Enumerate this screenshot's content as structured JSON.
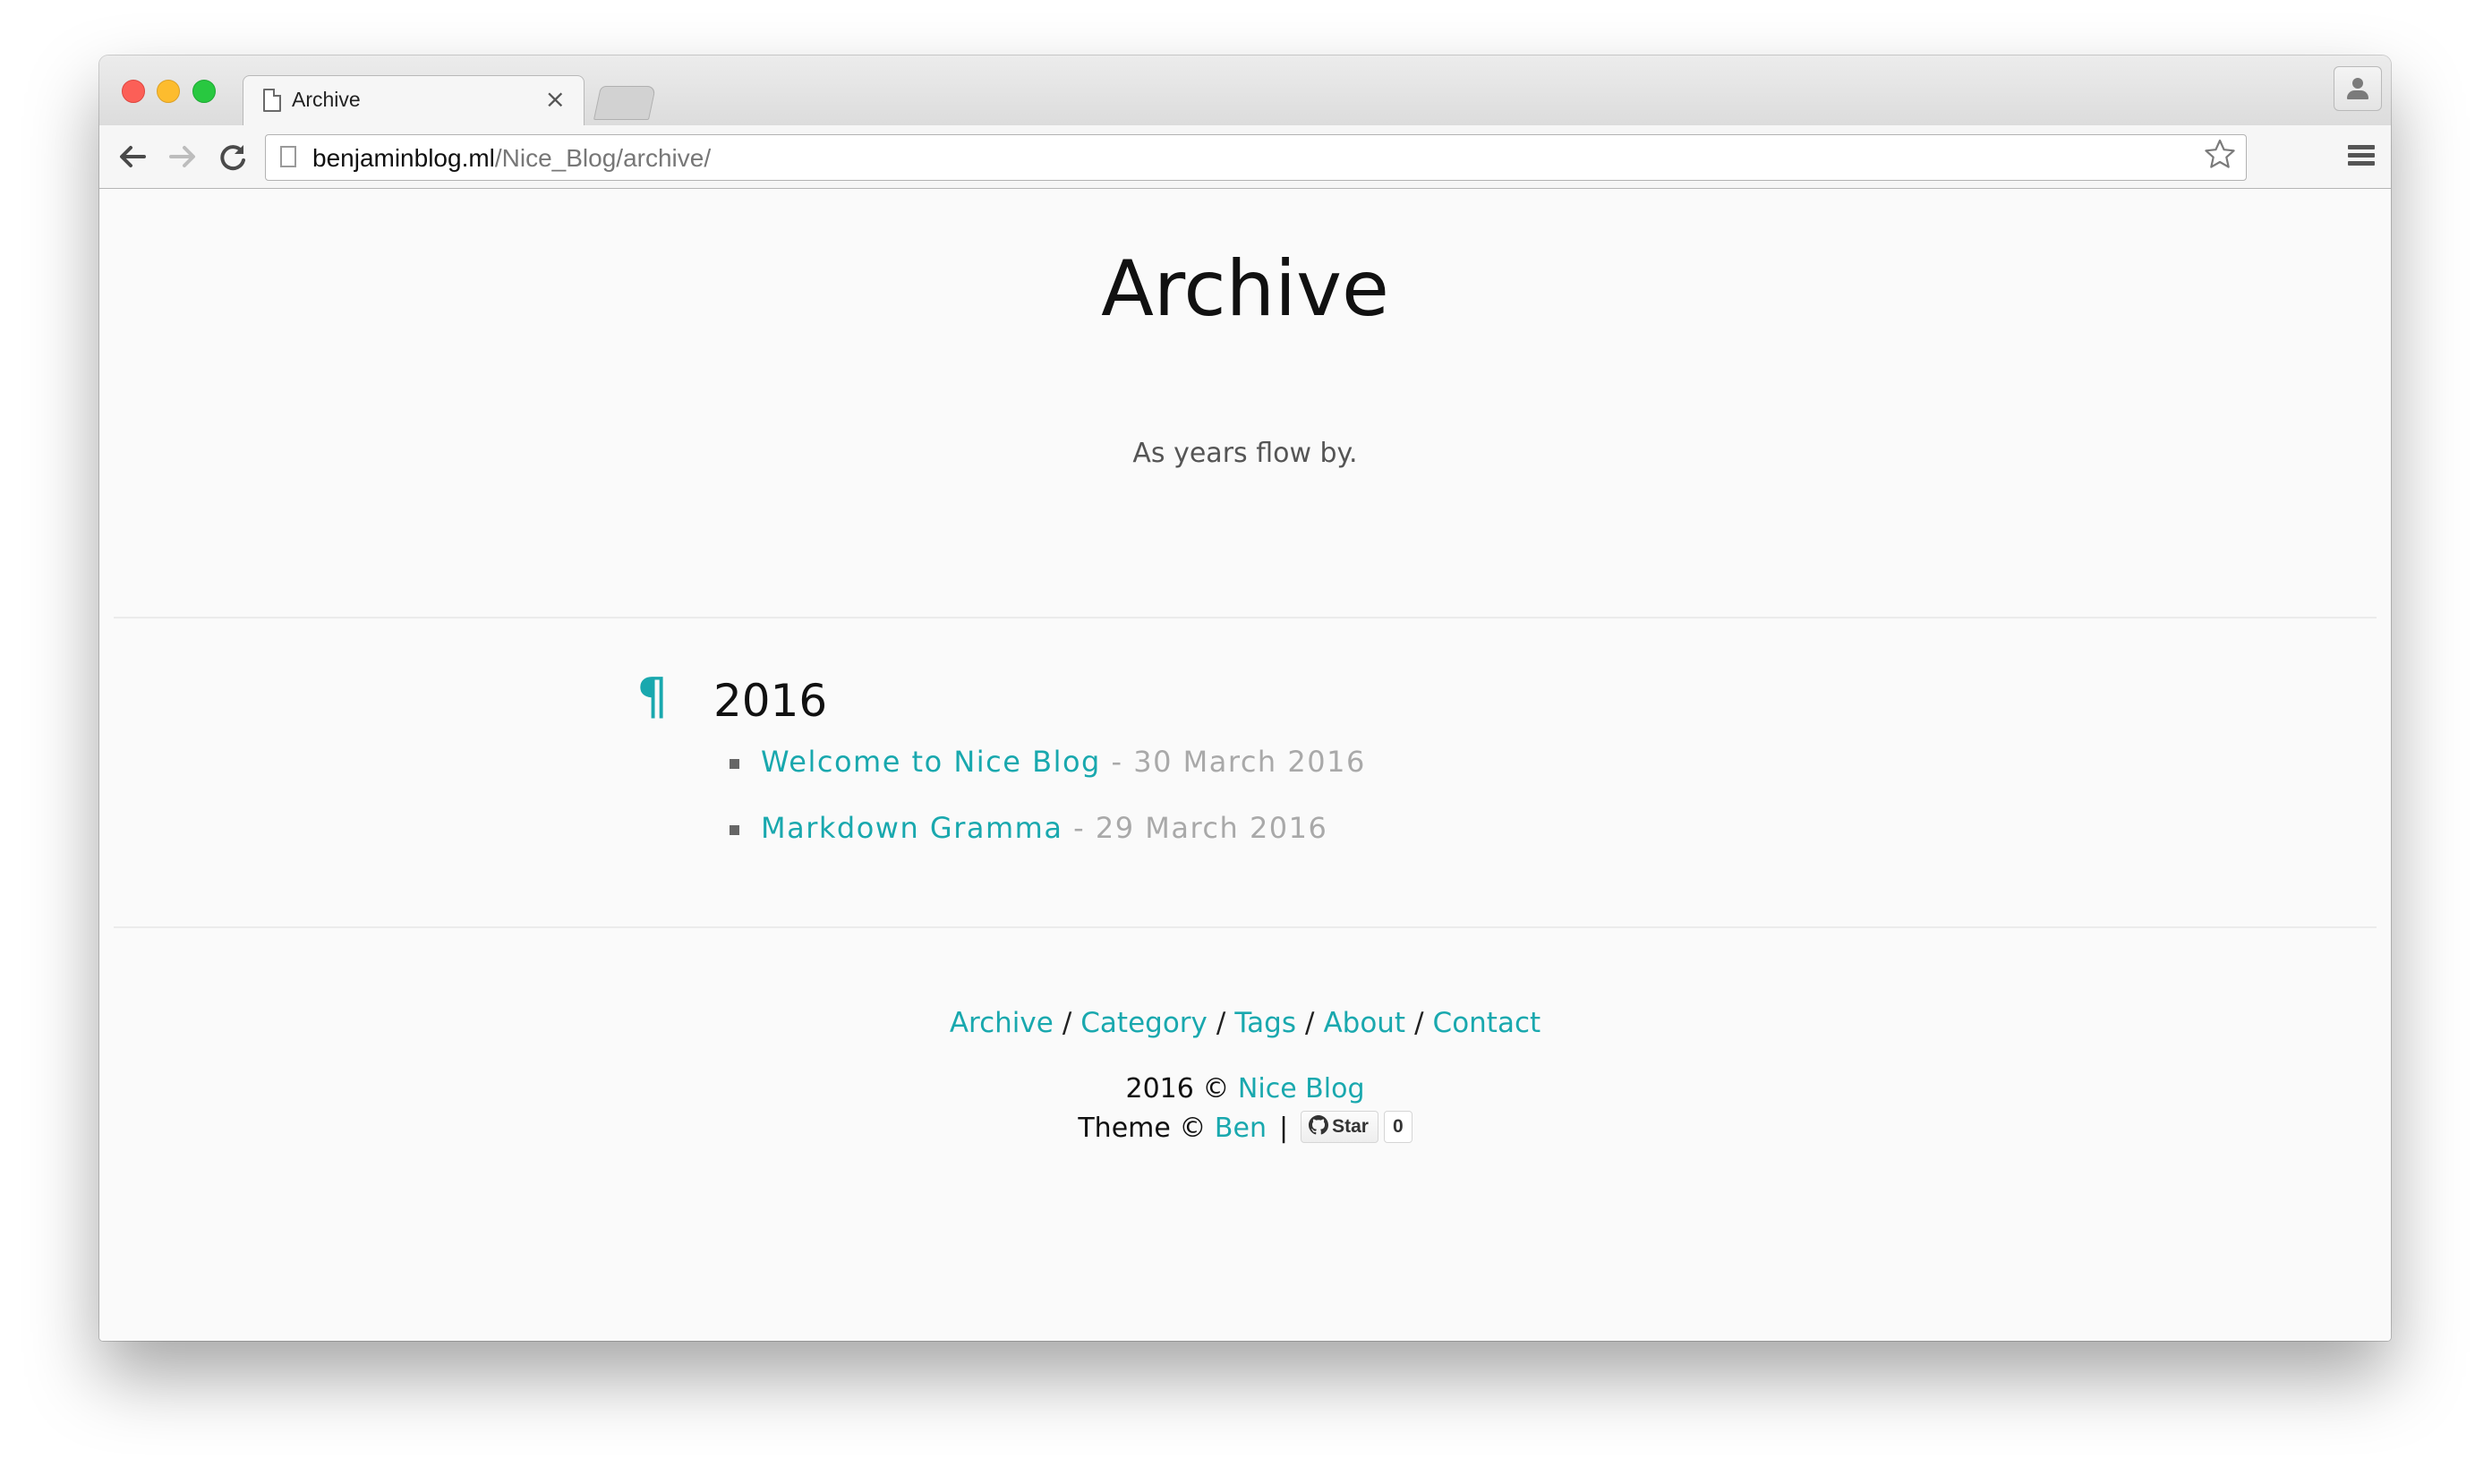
{
  "browser": {
    "tab_title": "Archive",
    "tab_close": "×",
    "url_host": "benjaminblog.ml",
    "url_path": "/Nice_Blog/archive/"
  },
  "header": {
    "title": "Archive",
    "subtitle": "As years flow by."
  },
  "archive": {
    "year_mark": "¶",
    "years": [
      {
        "year": "2016",
        "posts": [
          {
            "title": "Welcome to Nice Blog",
            "date": "- 30 March 2016"
          },
          {
            "title": "Markdown Gramma",
            "date": "- 29 March 2016"
          }
        ]
      }
    ]
  },
  "footer": {
    "nav": [
      "Archive",
      "Category",
      "Tags",
      "About",
      "Contact"
    ],
    "separator": "/",
    "copyright_prefix": "2016 ©",
    "copyright_link": "Nice Blog",
    "theme_prefix": "Theme ©",
    "theme_link": "Ben",
    "pipe": "|",
    "github_star_label": "Star",
    "github_star_count": "0"
  },
  "colors": {
    "accent": "#19a8ae",
    "date": "#a9a9a9",
    "page_bg": "#fafafa"
  },
  "icons": [
    "page-icon",
    "close-icon",
    "back-arrow-icon",
    "forward-arrow-icon",
    "reload-icon",
    "star-icon",
    "menu-icon",
    "profile-icon",
    "pilcrow-icon",
    "github-icon"
  ]
}
